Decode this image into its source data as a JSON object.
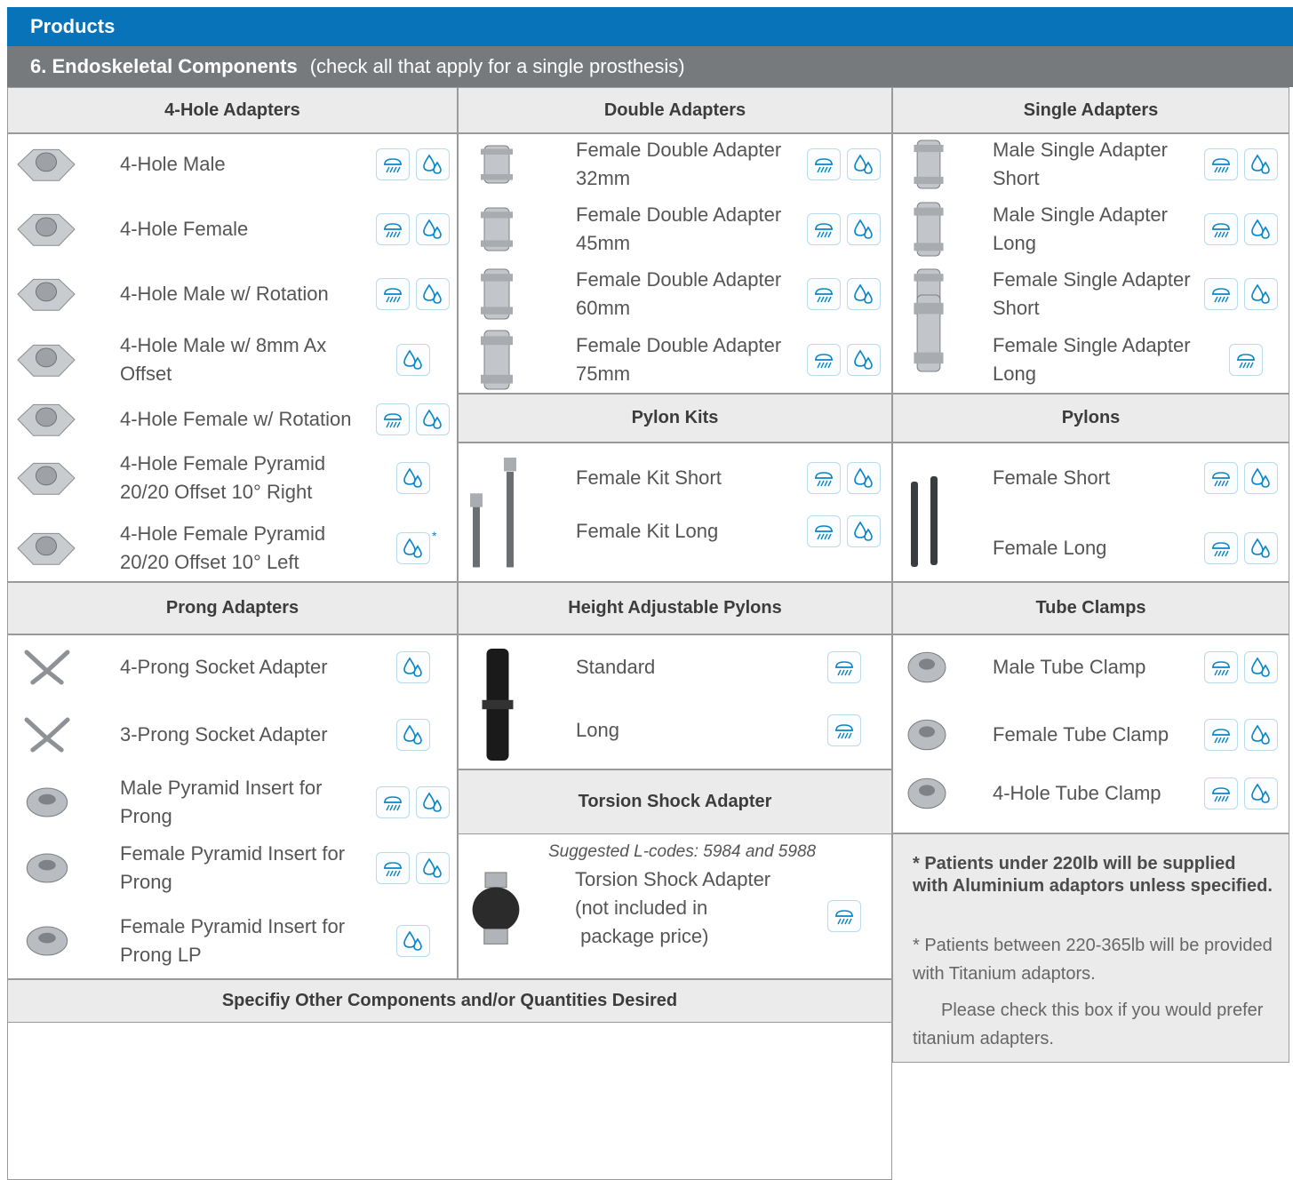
{
  "header": {
    "title": "Products"
  },
  "section": {
    "title": "6. Endoskeletal Components",
    "subtitle": "(check all that apply for a single prosthesis)"
  },
  "groups": {
    "four_hole": {
      "title": "4-Hole Adapters",
      "items": [
        {
          "label": "4-Hole Male",
          "icons": [
            "weather-icon",
            "water-drops-icon"
          ]
        },
        {
          "label": "4-Hole Female",
          "icons": [
            "weather-icon",
            "water-drops-icon"
          ]
        },
        {
          "label": "4-Hole Male w/ Rotation",
          "icons": [
            "weather-icon",
            "water-drops-icon"
          ]
        },
        {
          "label": "4-Hole Male w/ 8mm Ax Offset",
          "icons": [
            "water-drops-icon"
          ]
        },
        {
          "label": "4-Hole Female w/ Rotation",
          "icons": [
            "weather-icon",
            "water-drops-icon"
          ]
        },
        {
          "label": "4-Hole Female Pyramid 20/20 Offset 10° Right",
          "icons": [
            "water-drops-icon"
          ]
        },
        {
          "label": "4-Hole Female Pyramid 20/20 Offset 10° Left",
          "icons": [
            "water-drops-icon"
          ],
          "mark": "*"
        }
      ]
    },
    "double": {
      "title": "Double Adapters",
      "items": [
        {
          "label": "Female Double Adapter 32mm",
          "icons": [
            "weather-icon",
            "water-drops-icon"
          ]
        },
        {
          "label": "Female Double Adapter 45mm",
          "icons": [
            "weather-icon",
            "water-drops-icon"
          ]
        },
        {
          "label": "Female Double Adapter 60mm",
          "icons": [
            "weather-icon",
            "water-drops-icon"
          ]
        },
        {
          "label": "Female Double Adapter 75mm",
          "icons": [
            "weather-icon",
            "water-drops-icon"
          ]
        }
      ]
    },
    "single": {
      "title": "Single Adapters",
      "items": [
        {
          "label": "Male Single Adapter Short",
          "icons": [
            "weather-icon",
            "water-drops-icon"
          ]
        },
        {
          "label": "Male Single Adapter Long",
          "icons": [
            "weather-icon",
            "water-drops-icon"
          ]
        },
        {
          "label": "Female Single Adapter Short",
          "icons": [
            "weather-icon",
            "water-drops-icon"
          ]
        },
        {
          "label": "Female Single Adapter Long",
          "icons": [
            "weather-icon"
          ]
        }
      ]
    },
    "pylon_kits": {
      "title": "Pylon Kits",
      "items": [
        {
          "label": "Female Kit Short",
          "icons": [
            "weather-icon",
            "water-drops-icon"
          ]
        },
        {
          "label": "Female Kit Long",
          "icons": [
            "weather-icon",
            "water-drops-icon"
          ]
        }
      ]
    },
    "pylons": {
      "title": "Pylons",
      "items": [
        {
          "label": "Female Short",
          "icons": [
            "weather-icon",
            "water-drops-icon"
          ]
        },
        {
          "label": "Female Long",
          "icons": [
            "weather-icon",
            "water-drops-icon"
          ]
        }
      ]
    },
    "prong": {
      "title": "Prong Adapters",
      "items": [
        {
          "label": "4-Prong Socket Adapter",
          "icons": [
            "water-drops-icon"
          ]
        },
        {
          "label": "3-Prong Socket Adapter",
          "icons": [
            "water-drops-icon"
          ]
        },
        {
          "label": "Male Pyramid Insert for Prong",
          "icons": [
            "weather-icon",
            "water-drops-icon"
          ]
        },
        {
          "label": "Female Pyramid Insert for Prong",
          "icons": [
            "weather-icon",
            "water-drops-icon"
          ]
        },
        {
          "label": "Female Pyramid Insert for Prong LP",
          "icons": [
            "water-drops-icon"
          ]
        }
      ]
    },
    "height_adj": {
      "title": "Height Adjustable Pylons",
      "items": [
        {
          "label": "Standard",
          "icons": [
            "weather-icon"
          ]
        },
        {
          "label": "Long",
          "icons": [
            "weather-icon"
          ]
        }
      ]
    },
    "tube_clamps": {
      "title": "Tube Clamps",
      "items": [
        {
          "label": "Male Tube Clamp",
          "icons": [
            "weather-icon",
            "water-drops-icon"
          ]
        },
        {
          "label": "Female Tube Clamp",
          "icons": [
            "weather-icon",
            "water-drops-icon"
          ]
        },
        {
          "label": "4-Hole Tube Clamp",
          "icons": [
            "weather-icon",
            "water-drops-icon"
          ]
        }
      ]
    },
    "torsion": {
      "title": "Torsion Shock Adapter",
      "suggested": "Suggested L-codes: 5984 and 5988",
      "label_lines": [
        "Torsion Shock Adapter",
        "(not included in",
        " package price)"
      ],
      "icons": [
        "weather-icon"
      ]
    },
    "other": {
      "title": "Specifiy Other Components and/or Quantities Desired"
    }
  },
  "notes": {
    "bold": "*  Patients under 220lb will be supplied with Aluminium adaptors unless specified.",
    "line1": "*  Patients between 220-365lb will be provided with Titanium adaptors.",
    "line2": "Please check this box if you would prefer titanium adapters."
  },
  "colors": {
    "header_blue": "#0873b9",
    "section_gray": "#767a7d",
    "icon_blue": "#0a86c8"
  }
}
